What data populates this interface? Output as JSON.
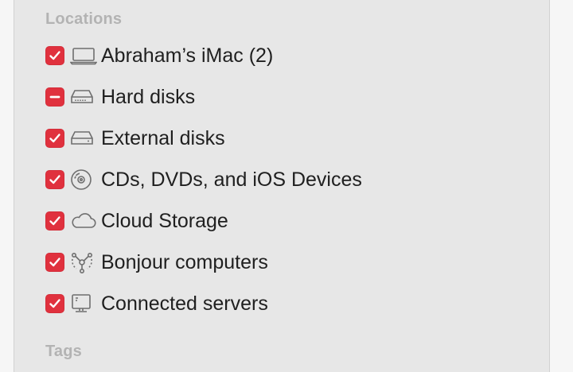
{
  "sections": {
    "locations_title": "Locations",
    "tags_title": "Tags"
  },
  "items": [
    {
      "label": "Abraham’s iMac (2)",
      "icon": "laptop-icon",
      "state": "checked"
    },
    {
      "label": "Hard disks",
      "icon": "hard-disk-icon",
      "state": "mixed"
    },
    {
      "label": "External disks",
      "icon": "external-disk-icon",
      "state": "checked"
    },
    {
      "label": "CDs, DVDs, and iOS Devices",
      "icon": "disc-icon",
      "state": "checked"
    },
    {
      "label": "Cloud Storage",
      "icon": "cloud-icon",
      "state": "checked"
    },
    {
      "label": "Bonjour computers",
      "icon": "bonjour-icon",
      "state": "checked"
    },
    {
      "label": "Connected servers",
      "icon": "server-icon",
      "state": "checked"
    }
  ],
  "colors": {
    "checkbox": "#e0313e",
    "panel": "#e7e7e7",
    "section_title": "#b3b3b3",
    "text": "#1f1f1f"
  }
}
